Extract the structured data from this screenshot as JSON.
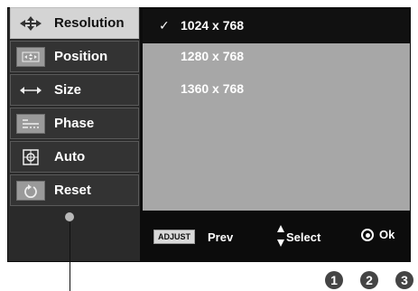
{
  "menu": {
    "items": [
      {
        "label": "Resolution",
        "icon": "move-arrows-icon",
        "active": true
      },
      {
        "label": "Position",
        "icon": "position-icon",
        "active": false
      },
      {
        "label": "Size",
        "icon": "size-arrows-icon",
        "active": false
      },
      {
        "label": "Phase",
        "icon": "phase-icon",
        "active": false
      },
      {
        "label": "Auto",
        "icon": "auto-adjust-icon",
        "active": false
      },
      {
        "label": "Reset",
        "icon": "reset-icon",
        "active": false
      }
    ]
  },
  "resolution": {
    "options": [
      "1024 x 768",
      "1280 x 768",
      "1360 x 768"
    ],
    "selected": "1024 x 768",
    "check": "✓"
  },
  "controls": {
    "adjust": "ADJUST",
    "prev": "Prev",
    "select": "Select",
    "ok": "Ok"
  },
  "callouts": [
    "1",
    "2",
    "3"
  ],
  "colors": {
    "osd_background": "#0c0c0c",
    "panel": "#a7a7a7",
    "active_item": "#d4d4d4"
  }
}
